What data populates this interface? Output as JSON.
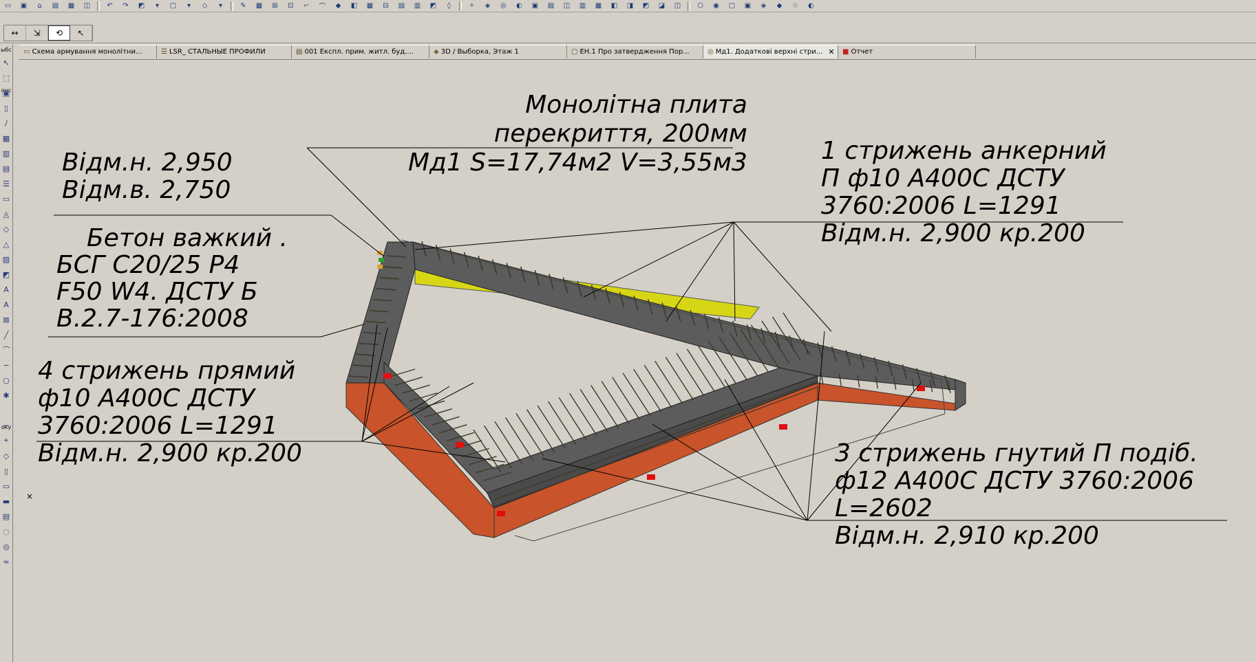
{
  "window": {
    "mode_buttons": [
      "↔",
      "⇲",
      "⟲",
      "↖"
    ]
  },
  "tabs": [
    {
      "label": "Схема армування монолітни...",
      "icon": "folder-icon",
      "active": false
    },
    {
      "label": "LSR_ СТАЛЬНЫЕ ПРОФИЛИ",
      "icon": "list-icon",
      "active": false
    },
    {
      "label": "001 Експл. прим. житл. буд....",
      "icon": "sheet-icon",
      "active": false
    },
    {
      "label": "3D / Выборка, Этаж 1",
      "icon": "cube-icon",
      "active": false
    },
    {
      "label": "ЕН.1 Про затвердження Пор...",
      "icon": "layout-icon",
      "active": false
    },
    {
      "label": "Мд1. Додаткові верхні стри...",
      "icon": "detail-icon",
      "active": true,
      "close": "✕"
    },
    {
      "label": "Отчет",
      "icon": "report-icon",
      "active": false
    }
  ],
  "toolbox": {
    "labels": [
      "ыбс",
      "онс",
      "оку"
    ]
  },
  "annotations": {
    "slab": [
      "Монолітна плита",
      "перекриття, 200мм",
      "Мд1 S=17,74м2 V=3,55м3"
    ],
    "levels": [
      "Відм.н.   2,950",
      "Відм.в.   2,750"
    ],
    "concrete": [
      "Бетон важкий .",
      "БСГ  С20/25 Р4",
      "F50 W4. ДСТУ Б",
      "В.2.7-176:2008"
    ],
    "bar1": [
      "1  стрижень анкерний",
      "П ф10 А400С ДСТУ",
      "3760:2006 L=1291",
      "Відм.н. 2,900 кр.200"
    ],
    "bar4": [
      "4  стрижень прямий",
      "ф10 А400С ДСТУ",
      "3760:2006 L=1291",
      "Відм.н. 2,900 кр.200"
    ],
    "bar3": [
      "3  стрижень гнутий П подіб.",
      "ф12 А400С ДСТУ 3760:2006",
      "L=2602",
      "Відм.н. 2,910 кр.200"
    ]
  },
  "colors": {
    "beam_top": "#5c5c5c",
    "beam_side": "#c9532a",
    "inner_face": "#d7d616",
    "rebar": "#3a3a2a",
    "marker": "#e01010"
  },
  "pin_close": "×"
}
